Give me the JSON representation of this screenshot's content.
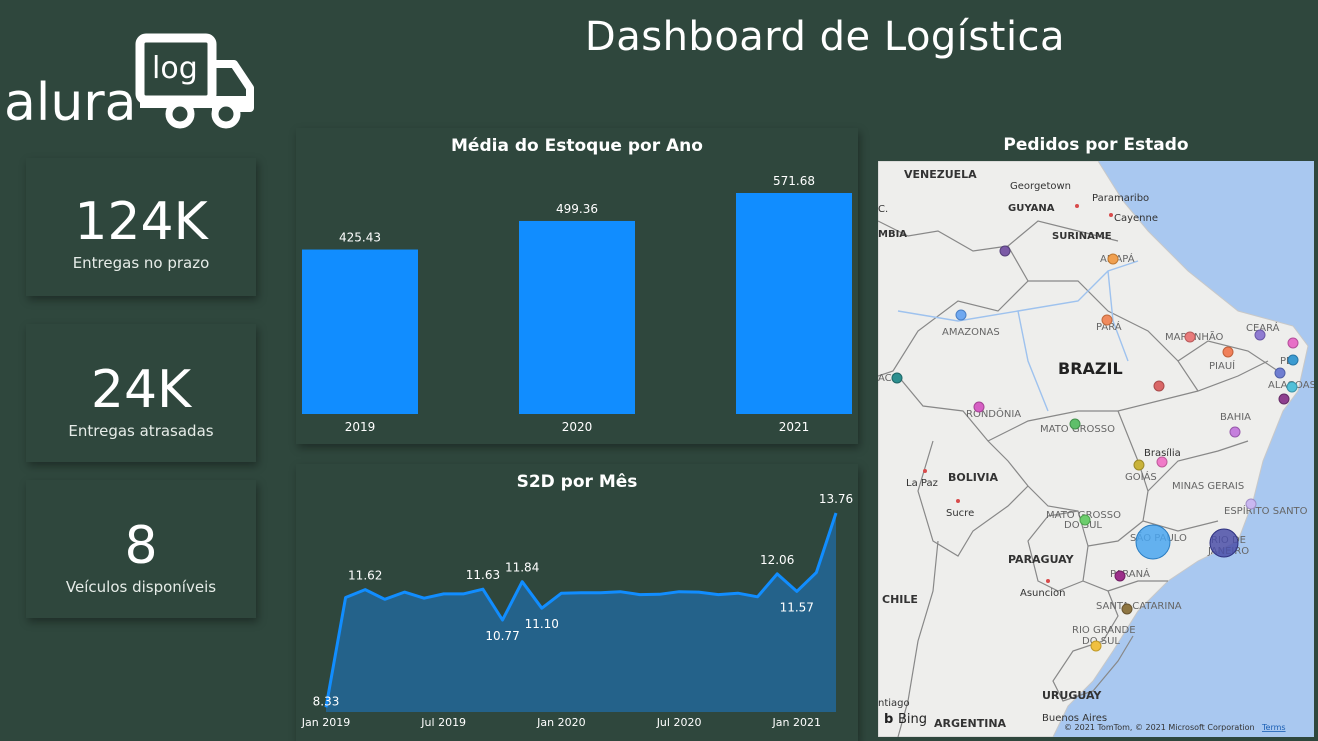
{
  "header": {
    "title": "Dashboard de Logística"
  },
  "logo": {
    "text": "alura",
    "badge": "log"
  },
  "kpis": [
    {
      "value": "124K",
      "label": "Entregas no prazo"
    },
    {
      "value": "24K",
      "label": "Entregas atrasadas"
    },
    {
      "value": "8",
      "label": "Veículos disponíveis"
    }
  ],
  "chart_data": [
    {
      "type": "bar",
      "title": "Média do Estoque por Ano",
      "categories": [
        "2019",
        "2020",
        "2021"
      ],
      "values": [
        425.43,
        499.36,
        571.68
      ],
      "value_labels": [
        "425.43",
        "499.36",
        "571.68"
      ],
      "color": "#118dff",
      "ylim": [
        0,
        600
      ]
    },
    {
      "type": "area",
      "title": "S2D por Mês",
      "x_ticks": [
        "Jan 2019",
        "Jul 2019",
        "Jan 2020",
        "Jul 2020",
        "Jan 2021"
      ],
      "values": [
        8.33,
        11.4,
        11.62,
        11.35,
        11.55,
        11.38,
        11.5,
        11.5,
        11.63,
        10.77,
        11.84,
        11.1,
        11.52,
        11.53,
        11.53,
        11.56,
        11.48,
        11.49,
        11.56,
        11.55,
        11.48,
        11.52,
        11.42,
        12.06,
        11.57,
        12.1,
        13.76
      ],
      "labels": [
        {
          "index": 0,
          "text": "8.33"
        },
        {
          "index": 2,
          "text": "11.62"
        },
        {
          "index": 8,
          "text": "11.63"
        },
        {
          "index": 9,
          "text": "10.77"
        },
        {
          "index": 10,
          "text": "11.84"
        },
        {
          "index": 11,
          "text": "11.10"
        },
        {
          "index": 23,
          "text": "12.06"
        },
        {
          "index": 24,
          "text": "11.57"
        },
        {
          "index": 26,
          "text": "13.76"
        }
      ],
      "ylim": [
        8.2,
        13.9
      ],
      "line_color": "#118dff",
      "fill_color": "#24628a"
    }
  ],
  "map": {
    "title": "Pedidos por Estado",
    "labels": {
      "venezuela": "VENEZUELA",
      "georgetown": "Georgetown",
      "paramaribo": "Paramaribo",
      "guyana": "GUYANA",
      "cayenne": "Cayenne",
      "suriname": "SURINAME",
      "mbia": "MBIA",
      "amapa": "AMAPÁ",
      "amazonas": "AMAZONAS",
      "para": "PARÁ",
      "maranhao": "MARANHÃO",
      "ceara": "CEARÁ",
      "brazil": "BRAZIL",
      "piaui": "PIAUÍ",
      "alagoas": "ALAGOAS",
      "pe": "PE",
      "rondonia": "RONDÔNIA",
      "bahia": "BAHIA",
      "mato_grosso": "MATO GROSSO",
      "brasilia": "Brasília",
      "bolivia": "BOLIVIA",
      "goias": "GOIÁS",
      "la_paz": "La Paz",
      "minas_gerais": "MINAS GERAIS",
      "sucre": "Sucre",
      "espirito_santo": "ESPÍRITO SANTO",
      "ms": "MATO GROSSO",
      "ms2": "DO SUL",
      "sao_paulo": "SÃO PAULO",
      "rio": "RIO DE",
      "rio2": "JANEIRO",
      "paraguay": "PARAGUAY",
      "parana": "PARANÁ",
      "asuncion": "Asuncion",
      "chile": "CHILE",
      "santa_catarina": "SANTA CATARINA",
      "rgs": "RIO GRANDE",
      "rgs2": "DO SUL",
      "uruguay": "URUGUAY",
      "santiago": "ntiago",
      "argentina": "ARGENTINA",
      "buenos_aires": "Buenos Aires",
      "cce": "ACE",
      "c": "C.",
      "bing": "Bing",
      "copyright": "© 2021 TomTom, © 2021 Microsoft Corporation",
      "terms": "Terms"
    }
  }
}
